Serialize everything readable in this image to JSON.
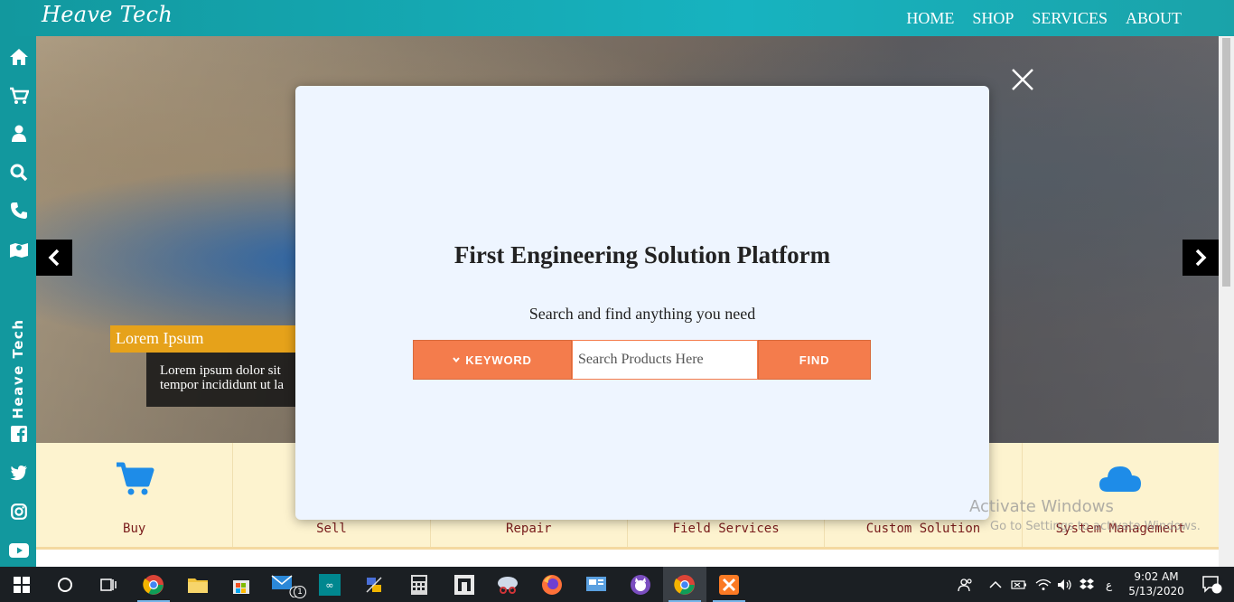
{
  "header": {
    "brand": "Heave Tech",
    "nav": [
      "HOME",
      "SHOP",
      "SERVICES",
      "ABOUT"
    ]
  },
  "sidebar": {
    "vertical_brand": "Heave Tech",
    "top_icons": [
      "home-icon",
      "cart-icon",
      "user-icon",
      "search-icon",
      "phone-icon",
      "map-icon"
    ],
    "social_icons": [
      "facebook-icon",
      "twitter-icon",
      "instagram-icon",
      "youtube-icon"
    ]
  },
  "hero": {
    "caption_title": "Lorem Ipsum",
    "caption_line1": "Lorem ipsum dolor sit",
    "caption_line2": "tempor incididunt ut la"
  },
  "features": [
    {
      "label": "Buy",
      "icon": "cart-icon"
    },
    {
      "label": "Sell",
      "icon": ""
    },
    {
      "label": "Repair",
      "icon": ""
    },
    {
      "label": "Field Services",
      "icon": ""
    },
    {
      "label": "Custom Solution",
      "icon": ""
    },
    {
      "label": "System Management",
      "icon": "cloud-icon"
    }
  ],
  "modal": {
    "title": "First Engineering Solution Platform",
    "subtitle": "Search and find anything you need",
    "keyword_label": "KEYWORD",
    "search_placeholder": "Search Products Here",
    "find_label": "FIND"
  },
  "watermark": {
    "title": "Activate Windows",
    "subtitle": "Go to Settings to activate Windows."
  },
  "taskbar": {
    "time": "9:02 AM",
    "date": "5/13/2020",
    "mail_badge": "1",
    "notification_count": "6",
    "ime": "ع"
  },
  "colors": {
    "teal": "#12989e",
    "orange": "#f47c4c",
    "feature_bg": "#fdf3cf",
    "modal_bg": "#eef5ff"
  }
}
